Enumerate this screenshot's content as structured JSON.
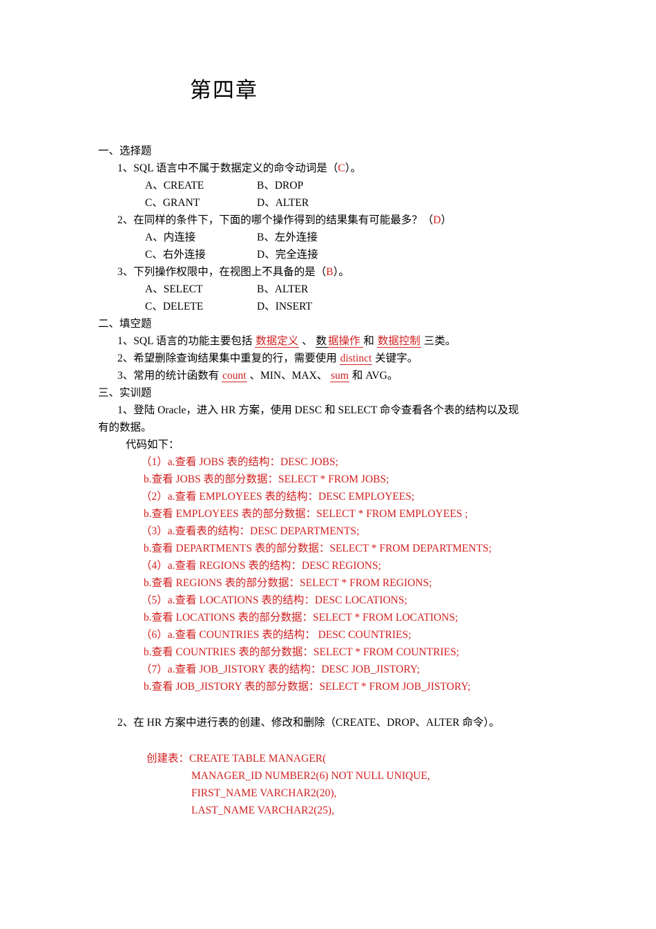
{
  "document": {
    "title": "第四章"
  },
  "section1": {
    "heading": "一、选择题",
    "questions": [
      {
        "stem_before": "1、SQL 语言中不属于数据定义的命令动词是（",
        "answer": "C",
        "stem_after": "）。",
        "options": [
          {
            "a": "A、CREATE",
            "b": "B、DROP"
          },
          {
            "a": "C、GRANT",
            "b": "D、ALTER"
          }
        ]
      },
      {
        "stem_before": "2、在同样的条件下，下面的哪个操作得到的结果集有可能最多？（",
        "answer": "D",
        "stem_after": "）",
        "options": [
          {
            "a": "A、内连接",
            "b": "B、左外连接"
          },
          {
            "a": "C、右外连接",
            "b": "D、完全连接"
          }
        ]
      },
      {
        "stem_before": "3、下列操作权限中，在视图上不具备的是（",
        "answer": "B",
        "stem_after": "）。",
        "options": [
          {
            "a": "A、SELECT",
            "b": "B、ALTER"
          },
          {
            "a": "C、DELETE",
            "b": "D、INSERT"
          }
        ]
      }
    ]
  },
  "section2": {
    "heading": "二、填空题",
    "q1": {
      "p1": "1、SQL 语言的功能主要包括 ",
      "blank1": "数据定义",
      "p2": " 、 ",
      "blank2a": "数",
      "blank2b": "据操作 ",
      "p3": "和 ",
      "blank3": "数据控制",
      "p4": " 三类。"
    },
    "q2": {
      "p1": "2、希望删除查询结果集中重复的行，需要使用 ",
      "blank1": "distinct",
      "p2": " 关键字。"
    },
    "q3": {
      "p1": "3、常用的统计函数有 ",
      "blank1": "count",
      "p2": " 、MIN、MAX、 ",
      "blank2": "sum",
      "p3": " 和 AVG。"
    }
  },
  "section3": {
    "heading": "三、实训题",
    "task1": {
      "line1": "1、登陆 Oracle，进入 HR 方案，使用 DESC 和 SELECT 命令查看各个表的结构以及现",
      "line2": "有的数据。",
      "code_label": "代码如下："
    },
    "code_lines": [
      {
        "text": "（1）a.查看 JOBS 表的结构：DESC JOBS;",
        "numbered": true
      },
      {
        "text": "b.查看 JOBS 表的部分数据：SELECT * FROM JOBS;",
        "numbered": false
      },
      {
        "text": "（2）a.查看 EMPLOYEES 表的结构：DESC EMPLOYEES;",
        "numbered": true
      },
      {
        "text": "b.查看 EMPLOYEES 表的部分数据：SELECT * FROM EMPLOYEES ;",
        "numbered": false
      },
      {
        "text": "（3）a.查看表的结构：DESC DEPARTMENTS;",
        "numbered": true
      },
      {
        "text": "b.查看 DEPARTMENTS 表的部分数据：SELECT * FROM DEPARTMENTS;",
        "numbered": false
      },
      {
        "text": "（4）a.查看 REGIONS 表的结构：DESC REGIONS;",
        "numbered": true
      },
      {
        "text": "b.查看 REGIONS 表的部分数据：SELECT * FROM REGIONS;",
        "numbered": false
      },
      {
        "text": "（5）a.查看 LOCATIONS 表的结构：DESC LOCATIONS;",
        "numbered": true
      },
      {
        "text": "b.查看 LOCATIONS 表的部分数据：SELECT * FROM LOCATIONS;",
        "numbered": false
      },
      {
        "text": "（6）a.查看 COUNTRIES 表的结构： DESC COUNTRIES;",
        "numbered": true
      },
      {
        "text": "b.查看 COUNTRIES 表的部分数据：SELECT * FROM COUNTRIES;",
        "numbered": false
      },
      {
        "text": "（7）a.查看 JOB_JISTORY 表的结构：DESC JOB_JISTORY;",
        "numbered": true
      },
      {
        "text": "b.查看 JOB_JISTORY 表的部分数据：SELECT * FROM JOB_JISTORY;",
        "numbered": false
      }
    ],
    "task2": {
      "line1": "2、在 HR 方案中进行表的创建、修改和删除（CREATE、DROP、ALTER 命令）。"
    },
    "create_table": {
      "label": "创建表：CREATE TABLE MANAGER(",
      "lines": [
        "MANAGER_ID NUMBER2(6) NOT NULL UNIQUE,",
        "FIRST_NAME VARCHAR2(20),",
        "LAST_NAME VARCHAR2(25),"
      ]
    }
  },
  "colors": {
    "answer_red": "#D32020",
    "text_black": "#000000",
    "page_background": "#FFFFFF"
  }
}
